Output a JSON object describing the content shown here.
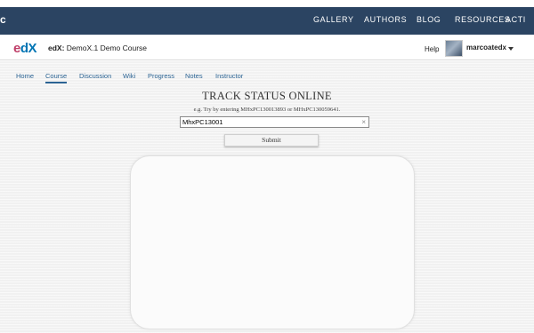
{
  "topbar": {
    "brand": "c",
    "nav": [
      "GALLERY",
      "AUTHORS",
      "BLOG",
      "RESOURCES",
      "ACTI"
    ]
  },
  "course": {
    "logo_e": "e",
    "logo_dx": "dX",
    "org_label": "edX:",
    "title": "DemoX.1 Demo Course"
  },
  "user": {
    "help": "Help",
    "username": "marcoatedx"
  },
  "tabs": [
    "Home",
    "Course",
    "Discussion",
    "Wiki",
    "Progress",
    "Notes",
    "Instructor"
  ],
  "active_tab": "Course",
  "tracker": {
    "title": "TRACK STATUS ONLINE",
    "hint": "e.g. Try by entering MHxPC130013893 or MHxPC130059641.",
    "input_value": "MhxPC13001",
    "clear_symbol": "×",
    "submit_label": "Submit"
  },
  "colors": {
    "topbar_bg": "#2b4462",
    "link": "#2c6494",
    "logo_e": "#bf3f69",
    "logo_dx": "#0075b4"
  }
}
